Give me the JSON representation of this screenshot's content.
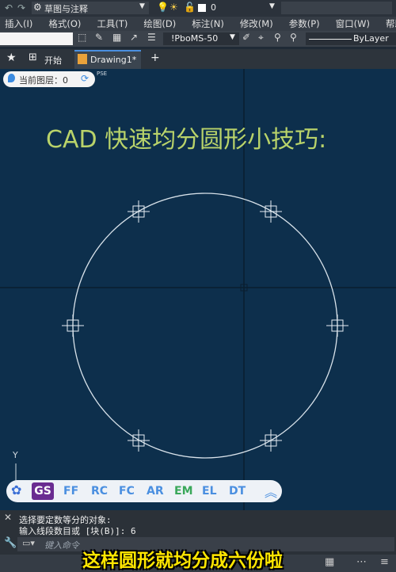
{
  "titlebar": {
    "workspace": "草图与注释",
    "layer_number": "0"
  },
  "menu": [
    "插入(I)",
    "格式(O)",
    "工具(T)",
    "绘图(D)",
    "标注(N)",
    "修改(M)",
    "参数(P)",
    "窗口(W)",
    "帮助"
  ],
  "toolbar": {
    "text_style": "!PboMS-50",
    "lineweight": "ByLayer"
  },
  "tabs": {
    "start": "开始",
    "drawing": "Drawing1*",
    "add": "+"
  },
  "layer_badge": {
    "label": "当前图层：0",
    "pse": "PSE"
  },
  "drawing": {
    "title": "CAD 快速均分圆形小技巧:",
    "axis_y": "Y"
  },
  "quick_bar": [
    "GS",
    "FF",
    "RC",
    "FC",
    "AR",
    "EM",
    "EL",
    "DT"
  ],
  "command": {
    "line1": "选择要定数等分的对象:",
    "line2": "输入线段数目或 [块(B)]: 6",
    "placeholder": "键入命令"
  },
  "subtitle": "这样圆形就均分成六份啦",
  "colors": {
    "canvas": "#0d2f4c",
    "title_text": "#b9d36a",
    "circle": "#d8e2ea",
    "subtitle": "#ffe600"
  }
}
